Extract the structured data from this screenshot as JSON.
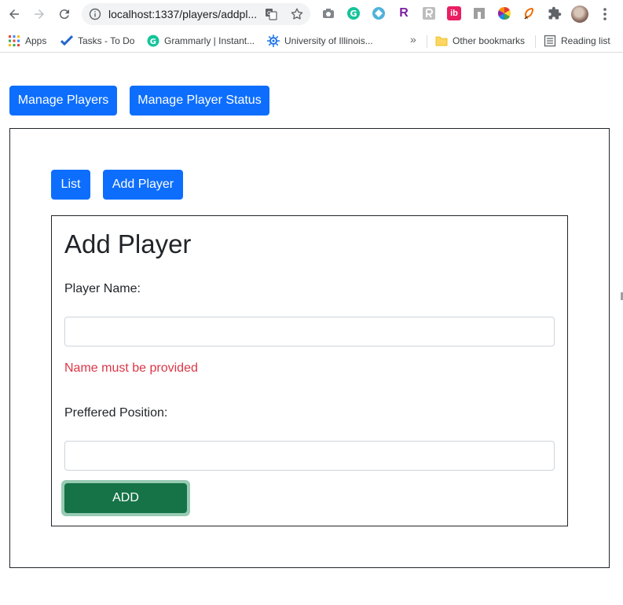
{
  "browser": {
    "url": "localhost:1337/players/addpl...",
    "bookmarks": {
      "apps": "Apps",
      "tasks": "Tasks - To Do",
      "grammarly": "Grammarly | Instant...",
      "illinois": "University of Illinois...",
      "overflow": "»",
      "other": "Other bookmarks",
      "reading": "Reading list"
    },
    "extensions": {
      "r_ext": "R",
      "ib_ext": "ib"
    }
  },
  "nav": {
    "manage_players": "Manage Players",
    "manage_status": "Manage Player Status"
  },
  "subnav": {
    "list": "List",
    "add_player": "Add Player"
  },
  "form": {
    "title": "Add Player",
    "name_label": "Player Name:",
    "name_value": "",
    "name_error": "Name must be provided",
    "position_label": "Preffered Position:",
    "position_value": "",
    "submit": "ADD"
  },
  "colors": {
    "primary": "#0d6efd",
    "success": "#157347",
    "danger": "#dc3545"
  }
}
